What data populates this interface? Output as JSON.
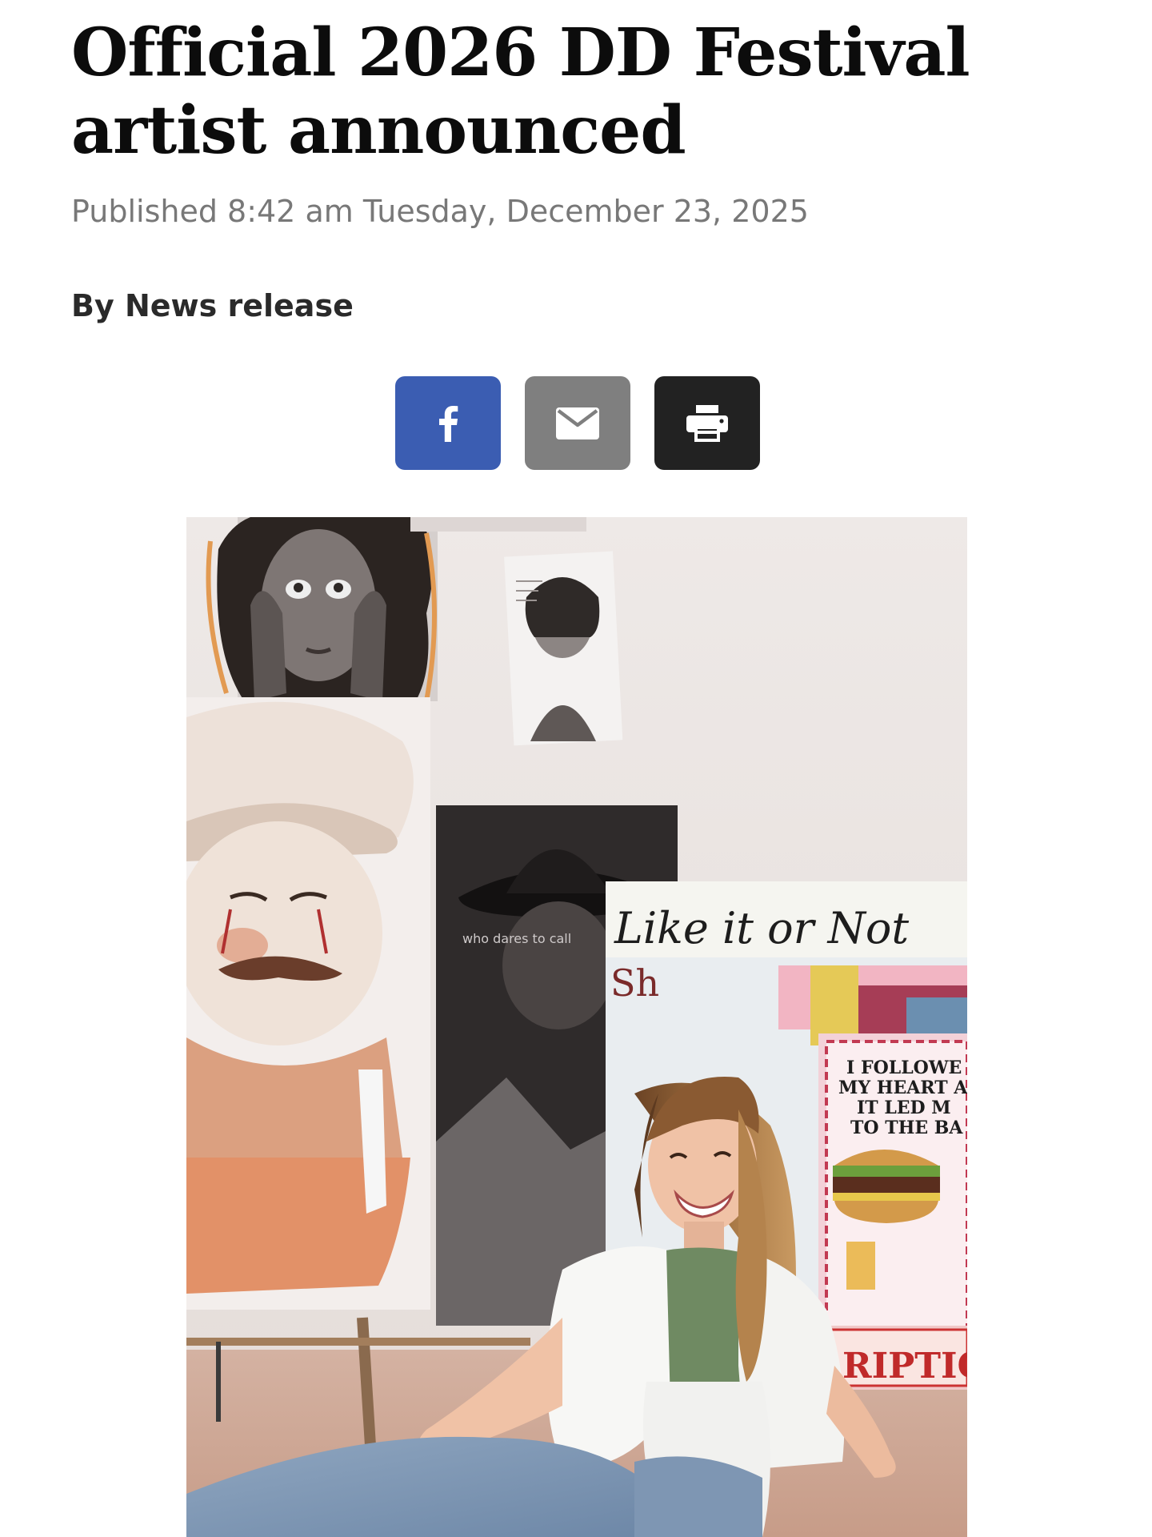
{
  "article": {
    "headline": "Official 2026 DD Festival artist announced",
    "published": "Published 8:42 am Tuesday, December 23, 2025",
    "byline": "By News release"
  },
  "share": {
    "buttons": [
      {
        "name": "facebook",
        "icon": "facebook-icon",
        "color": "#3b5db2"
      },
      {
        "name": "email",
        "icon": "mail-icon",
        "color": "#7f7f7f"
      },
      {
        "name": "print",
        "icon": "printer-icon",
        "color": "#222222"
      }
    ]
  },
  "photo": {
    "painting_texts": {
      "like_it": "Like it or Not",
      "sign_line1": "I FOLLOWE",
      "sign_line2": "MY HEART A",
      "sign_line3": "IT LED M",
      "sign_line4": "TO THE BA",
      "banner": "RIPTION",
      "hat_caption": "who dares to call",
      "fragment": "Sh"
    }
  }
}
